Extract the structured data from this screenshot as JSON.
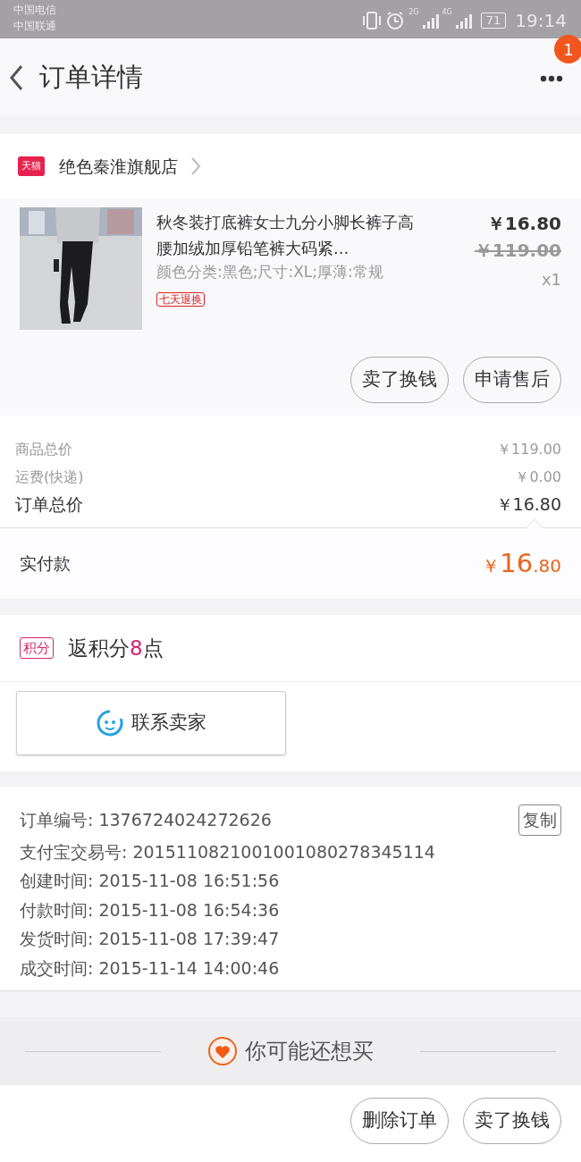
{
  "status_bar": {
    "carriers": [
      "中国电信",
      "中国联通"
    ],
    "networks": [
      "2G",
      "4G"
    ],
    "battery": "71",
    "time": "19:14"
  },
  "header": {
    "title": "订单详情",
    "badge": "1"
  },
  "store": {
    "tag": "天猫",
    "name": "绝色秦淮旗舰店"
  },
  "item": {
    "title": "秋冬装打底裤女士九分小脚长裤子高腰加绒加厚铅笔裤大码紧...",
    "spec": "颜色分类:黑色;尺寸:XL;厚薄:常规",
    "service_tag": "七天退换",
    "price": "￥16.80",
    "original_price": "￥119.00",
    "quantity": "x1",
    "actions": [
      "卖了换钱",
      "申请售后"
    ]
  },
  "summary": [
    {
      "label": "商品总价",
      "value": "￥119.00",
      "emphasis": false
    },
    {
      "label": "运费(快递)",
      "value": "￥0.00",
      "emphasis": false
    },
    {
      "label": "订单总价",
      "value": "￥16.80",
      "emphasis": true
    }
  ],
  "paid": {
    "label": "实付款",
    "currency": "￥",
    "integer": "16",
    "decimal": ".80"
  },
  "points": {
    "tag": "积分",
    "text": "返积分**8**点"
  },
  "contact": {
    "label": "联系卖家"
  },
  "details": [
    {
      "label": "订单编号:",
      "value": "1376724024272626",
      "copy": "复制"
    },
    {
      "label": "支付宝交易号:",
      "value": "2015110821001001080278345114"
    },
    {
      "label": "创建时间:",
      "value": "2015-11-08 16:51:56"
    },
    {
      "label": "付款时间:",
      "value": "2015-11-08 16:54:36"
    },
    {
      "label": "发货时间:",
      "value": "2015-11-08 17:39:47"
    },
    {
      "label": "成交时间:",
      "value": "2015-11-14 14:00:46"
    }
  ],
  "recommend": {
    "title": "你可能还想买"
  },
  "bottom_actions": [
    "删除订单",
    "卖了换钱"
  ]
}
